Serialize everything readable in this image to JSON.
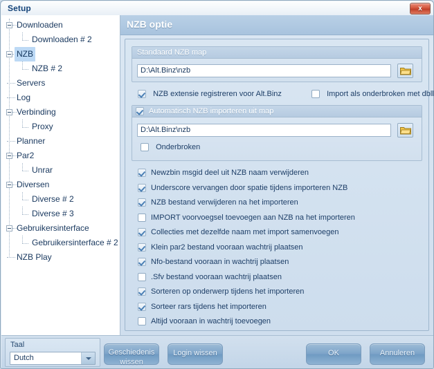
{
  "window": {
    "title": "Setup",
    "close_label": "x"
  },
  "sidebar": {
    "items": [
      {
        "label": "Downloaden",
        "level": 0,
        "expander": true,
        "selected": false
      },
      {
        "label": "Downloaden # 2",
        "level": 1,
        "expander": false,
        "selected": false
      },
      {
        "label": "NZB",
        "level": 0,
        "expander": true,
        "selected": true
      },
      {
        "label": "NZB # 2",
        "level": 1,
        "expander": false,
        "selected": false
      },
      {
        "label": "Servers",
        "level": 0,
        "expander": false,
        "selected": false
      },
      {
        "label": "Log",
        "level": 0,
        "expander": false,
        "selected": false
      },
      {
        "label": "Verbinding",
        "level": 0,
        "expander": true,
        "selected": false
      },
      {
        "label": "Proxy",
        "level": 1,
        "expander": false,
        "selected": false
      },
      {
        "label": "Planner",
        "level": 0,
        "expander": false,
        "selected": false
      },
      {
        "label": "Par2",
        "level": 0,
        "expander": true,
        "selected": false
      },
      {
        "label": "Unrar",
        "level": 1,
        "expander": false,
        "selected": false
      },
      {
        "label": "Diversen",
        "level": 0,
        "expander": true,
        "selected": false
      },
      {
        "label": "Diverse # 2",
        "level": 1,
        "expander": false,
        "selected": false
      },
      {
        "label": "Diverse # 3",
        "level": 1,
        "expander": false,
        "selected": false
      },
      {
        "label": "Gebruikersinterface",
        "level": 0,
        "expander": true,
        "selected": false
      },
      {
        "label": "Gebruikersinterface # 2",
        "level": 1,
        "expander": false,
        "selected": false
      },
      {
        "label": "NZB Play",
        "level": 0,
        "expander": false,
        "selected": false
      }
    ]
  },
  "main": {
    "header_title": "NZB optie",
    "default_map_group": {
      "title": "Standaard NZB map",
      "path_value": "D:\\Alt.Binz\\nzb",
      "browse_icon": "folder-icon"
    },
    "row_after_default": [
      {
        "label": "NZB extensie registreren voor Alt.Binz",
        "checked": true
      },
      {
        "label": "Import als onderbroken met dblklik",
        "checked": false
      }
    ],
    "auto_import_group": {
      "title": "Automatisch NZB importeren uit map",
      "title_checked": true,
      "path_value": "D:\\Alt.Binz\\nzb",
      "browse_icon": "folder-icon",
      "paused_label": "Onderbroken",
      "paused_checked": false
    },
    "options": [
      {
        "label": "Newzbin msgid deel uit NZB naam verwijderen",
        "checked": true
      },
      {
        "label": "Underscore vervangen door spatie tijdens importeren NZB",
        "checked": true
      },
      {
        "label": "NZB bestand verwijderen na het importeren",
        "checked": true
      },
      {
        "label": "IMPORT voorvoegsel toevoegen aan NZB na het importeren",
        "checked": false
      },
      {
        "label": "Collecties met dezelfde naam met import samenvoegen",
        "checked": true
      },
      {
        "label": "Klein par2 bestand vooraan wachtrij plaatsen",
        "checked": true
      },
      {
        "label": "Nfo-bestand vooraan in wachtrij plaatsen",
        "checked": true
      },
      {
        "label": ".Sfv bestand vooraan wachtrij plaatsen",
        "checked": false
      },
      {
        "label": "Sorteren op onderwerp tijdens het importeren",
        "checked": true
      },
      {
        "label": "Sorteer rars tijdens het importeren",
        "checked": true
      },
      {
        "label": "Altijd vooraan in wachtrij toevoegen",
        "checked": false
      }
    ]
  },
  "footer": {
    "language_label": "Taal",
    "language_value": "Dutch",
    "clear_history_label": "Geschiedenis\nwissen",
    "clear_history_line1": "Geschiedenis",
    "clear_history_line2": "wissen",
    "clear_login_label": "Login wissen",
    "ok_label": "OK",
    "cancel_label": "Annuleren"
  },
  "colors": {
    "accent": "#a8c3de",
    "selection": "#bcd9f5",
    "text": "#1d3e67",
    "close_button": "#c0402a",
    "folder_icon": "#f0bd3a"
  }
}
